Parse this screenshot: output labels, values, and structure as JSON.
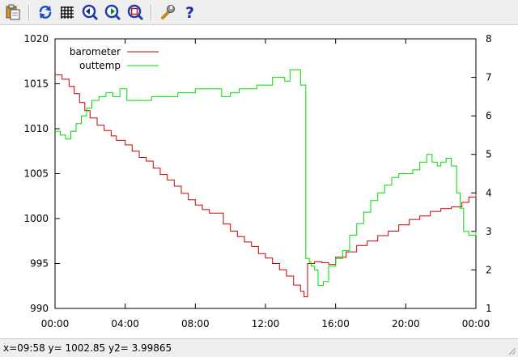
{
  "toolbar": {
    "buttons": [
      {
        "name": "copy-clipboard",
        "icon": "clipboard-icon"
      },
      {
        "name": "replot",
        "icon": "refresh-icon"
      },
      {
        "name": "grid",
        "icon": "grid-icon"
      },
      {
        "name": "previous-zoom",
        "icon": "zoom-back-icon"
      },
      {
        "name": "next-zoom",
        "icon": "zoom-forward-icon"
      },
      {
        "name": "autoscale",
        "icon": "zoom-fit-icon"
      },
      {
        "name": "settings",
        "icon": "wrench-icon"
      },
      {
        "name": "help",
        "icon": "help-icon"
      }
    ]
  },
  "status": {
    "text": "x=09:58 y= 1002.85 y2= 3.99865"
  },
  "chart_data": {
    "type": "line",
    "grid": false,
    "legend_position": "top-left",
    "x_ticks": [
      "00:00",
      "04:00",
      "08:00",
      "12:00",
      "16:00",
      "20:00",
      "00:00"
    ],
    "y_ticks": [
      "990",
      "995",
      "1000",
      "1005",
      "1010",
      "1015",
      "1020"
    ],
    "y2_ticks": [
      "1",
      "2",
      "3",
      "4",
      "5",
      "6",
      "7",
      "8"
    ],
    "xlim_hours": [
      0,
      24
    ],
    "ylim": [
      990,
      1020
    ],
    "y2lim": [
      1,
      8
    ],
    "colors": {
      "barometer": "#cc0000",
      "outtemp": "#00dd00"
    },
    "series": [
      {
        "name": "barometer",
        "axis": "y",
        "x_hours": [
          0,
          0.4,
          0.8,
          1.1,
          1.4,
          1.7,
          2.0,
          2.4,
          2.8,
          3.2,
          3.5,
          4.0,
          4.4,
          4.8,
          5.2,
          5.6,
          6.0,
          6.4,
          6.8,
          7.2,
          7.6,
          8.0,
          8.4,
          8.8,
          9.2,
          9.6,
          10.0,
          10.4,
          10.8,
          11.2,
          11.6,
          12.0,
          12.4,
          12.8,
          13.2,
          13.6,
          14.0,
          14.2,
          14.4,
          14.8,
          15.2,
          15.6,
          16.0,
          16.6,
          17.2,
          17.8,
          18.4,
          19.0,
          19.6,
          20.2,
          20.8,
          21.4,
          22.0,
          22.6,
          23.2,
          23.6,
          24.0
        ],
        "values": [
          1016.0,
          1015.5,
          1014.7,
          1013.9,
          1012.9,
          1012.0,
          1011.2,
          1010.4,
          1009.8,
          1009.2,
          1008.7,
          1008.2,
          1007.5,
          1006.8,
          1006.4,
          1005.6,
          1004.9,
          1004.3,
          1003.6,
          1002.8,
          1002.1,
          1001.5,
          1001.0,
          1000.6,
          1000.6,
          999.4,
          998.6,
          998.0,
          997.4,
          996.9,
          996.1,
          995.6,
          995.0,
          994.3,
          993.6,
          992.6,
          991.9,
          991.3,
          995.0,
          995.2,
          995.1,
          994.9,
          995.7,
          996.3,
          997.0,
          997.5,
          998.1,
          998.6,
          999.3,
          999.9,
          1000.3,
          1000.8,
          1001.1,
          1001.3,
          1001.8,
          1002.4,
          1002.7
        ]
      },
      {
        "name": "outtemp",
        "axis": "y2",
        "x_hours": [
          0,
          0.3,
          0.6,
          0.9,
          1.2,
          1.5,
          1.8,
          2.1,
          2.5,
          2.9,
          3.3,
          3.7,
          4.1,
          4.5,
          5.0,
          5.5,
          6.0,
          6.5,
          7.0,
          7.5,
          8.0,
          8.5,
          9.0,
          9.5,
          10.0,
          10.5,
          11.0,
          11.5,
          12.0,
          12.4,
          12.8,
          13.1,
          13.4,
          13.7,
          14.0,
          14.3,
          14.5,
          14.6,
          14.8,
          15.0,
          15.3,
          15.6,
          16.0,
          16.4,
          16.8,
          17.2,
          17.6,
          18.0,
          18.4,
          18.8,
          19.2,
          19.6,
          20.0,
          20.4,
          20.8,
          21.2,
          21.5,
          21.8,
          22.0,
          22.3,
          22.6,
          22.9,
          23.1,
          23.3,
          23.6,
          24.0
        ],
        "values": [
          5.6,
          5.5,
          5.4,
          5.6,
          5.8,
          6.0,
          6.2,
          6.4,
          6.5,
          6.6,
          6.5,
          6.7,
          6.4,
          6.4,
          6.4,
          6.5,
          6.5,
          6.5,
          6.6,
          6.6,
          6.7,
          6.7,
          6.7,
          6.5,
          6.6,
          6.7,
          6.7,
          6.8,
          6.8,
          7.0,
          7.0,
          6.9,
          7.2,
          7.2,
          6.8,
          2.3,
          2.2,
          2.1,
          2.0,
          1.6,
          1.7,
          2.1,
          2.3,
          2.5,
          2.9,
          3.2,
          3.5,
          3.8,
          4.0,
          4.2,
          4.4,
          4.5,
          4.5,
          4.6,
          4.8,
          5.0,
          4.8,
          4.7,
          4.8,
          4.9,
          4.7,
          4.0,
          3.6,
          3.0,
          2.9,
          3.0
        ]
      }
    ]
  }
}
